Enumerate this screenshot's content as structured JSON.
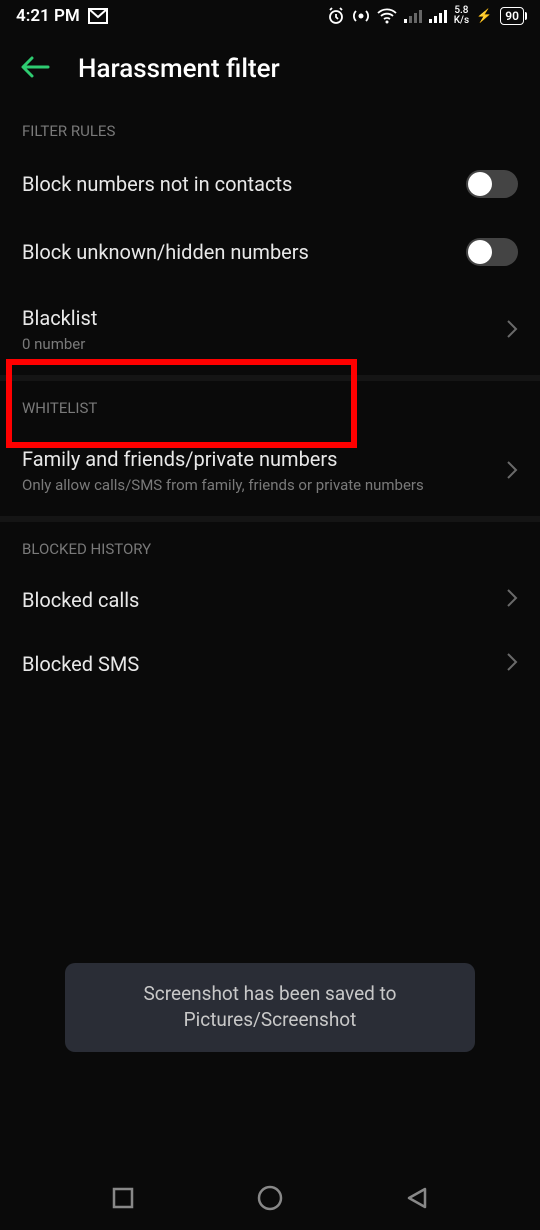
{
  "status": {
    "time": "4:21 PM",
    "net_speed_top": "5.8",
    "net_speed_bottom": "K/s",
    "battery": "90"
  },
  "header": {
    "title": "Harassment filter"
  },
  "sections": {
    "filter_rules": {
      "label": "Filter Rules",
      "items": {
        "block_not_contacts": {
          "title": "Block numbers not in contacts"
        },
        "block_unknown": {
          "title": "Block unknown/hidden numbers"
        },
        "blacklist": {
          "title": "Blacklist",
          "sub": "0 number"
        }
      }
    },
    "whitelist": {
      "label": "Whitelist",
      "items": {
        "family": {
          "title": "Family and friends/private numbers",
          "sub": "Only allow calls/SMS from family, friends or private numbers"
        }
      }
    },
    "blocked_history": {
      "label": "Blocked History",
      "items": {
        "calls": {
          "title": "Blocked calls"
        },
        "sms": {
          "title": "Blocked SMS"
        }
      }
    }
  },
  "toast": "Screenshot has been saved to  Pictures/Screenshot"
}
